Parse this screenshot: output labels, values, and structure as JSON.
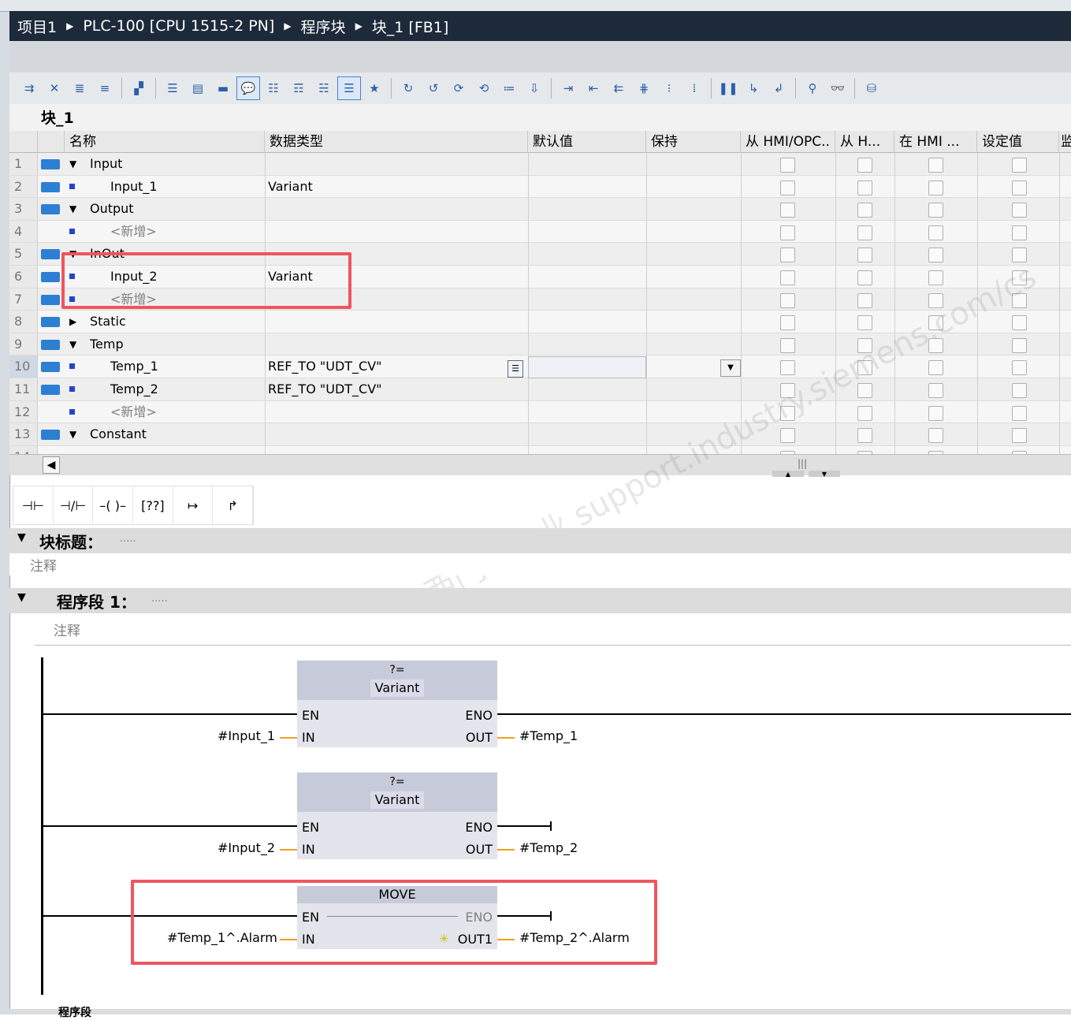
{
  "breadcrumb": [
    "项目1",
    "PLC-100 [CPU 1515-2 PN]",
    "程序块",
    "块_1 [FB1]"
  ],
  "block_name": "块_1",
  "table": {
    "headers": [
      "名称",
      "数据类型",
      "默认值",
      "保持",
      "从 HMI/OPC..",
      "从 H...",
      "在 HMI ...",
      "设定值",
      "监"
    ],
    "rows": [
      {
        "n": "1",
        "indent": 0,
        "expander": "▼",
        "name": "Input",
        "type": ""
      },
      {
        "n": "2",
        "indent": 1,
        "expander": "",
        "name": "Input_1",
        "type": "Variant"
      },
      {
        "n": "3",
        "indent": 0,
        "expander": "▼",
        "name": "Output",
        "type": ""
      },
      {
        "n": "4",
        "indent": 1,
        "expander": "",
        "name": "<新增>",
        "type": ""
      },
      {
        "n": "5",
        "indent": 0,
        "expander": "▼",
        "name": "InOut",
        "type": ""
      },
      {
        "n": "6",
        "indent": 1,
        "expander": "",
        "name": "Input_2",
        "type": "Variant"
      },
      {
        "n": "7",
        "indent": 1,
        "expander": "",
        "name": "<新增>",
        "type": ""
      },
      {
        "n": "8",
        "indent": 0,
        "expander": "▶",
        "name": "Static",
        "type": ""
      },
      {
        "n": "9",
        "indent": 0,
        "expander": "▼",
        "name": "Temp",
        "type": ""
      },
      {
        "n": "10",
        "indent": 1,
        "expander": "",
        "name": "Temp_1",
        "type": "REF_TO \"UDT_CV\""
      },
      {
        "n": "11",
        "indent": 1,
        "expander": "",
        "name": "Temp_2",
        "type": "REF_TO \"UDT_CV\""
      },
      {
        "n": "12",
        "indent": 1,
        "expander": "",
        "name": "<新增>",
        "type": ""
      },
      {
        "n": "13",
        "indent": 0,
        "expander": "▼",
        "name": "Constant",
        "type": ""
      }
    ],
    "hidden_row_name": "<新增>",
    "row_icon_text": "◁III"
  },
  "ladder_tools": [
    "⊣⊢",
    "⊣/⊢",
    "–( )–",
    "[??]",
    "↦",
    "↱"
  ],
  "block_title": {
    "label": "块标题：",
    "placeholder": "....."
  },
  "block_comment": "注释",
  "segment": {
    "label": "程序段 1：",
    "placeholder": "....."
  },
  "segment_comment": "注释",
  "boxes": [
    {
      "op": "?=",
      "type": "Variant",
      "en": "EN",
      "eno": "ENO",
      "in": "IN",
      "out": "OUT",
      "in_var": "#Input_1",
      "out_var": "#Temp_1"
    },
    {
      "op": "?=",
      "type": "Variant",
      "en": "EN",
      "eno": "ENO",
      "in": "IN",
      "out": "OUT",
      "in_var": "#Input_2",
      "out_var": "#Temp_2"
    },
    {
      "op": "MOVE",
      "en": "EN",
      "eno": "ENO",
      "in": "IN",
      "out": "OUT1",
      "in_var": "#Temp_1^.Alarm",
      "out_var": "#Temp_2^.Alarm"
    }
  ],
  "next_segment": "程序段",
  "watermark": "西门子工业  support.industry.siemens.com/cs",
  "colors": {
    "highlight": "#ee5560",
    "wire_in": "#f0a020",
    "box": "#e4e4ec",
    "box_head": "#c7cad9",
    "breadcrumb_bg": "#1d2a3a"
  }
}
